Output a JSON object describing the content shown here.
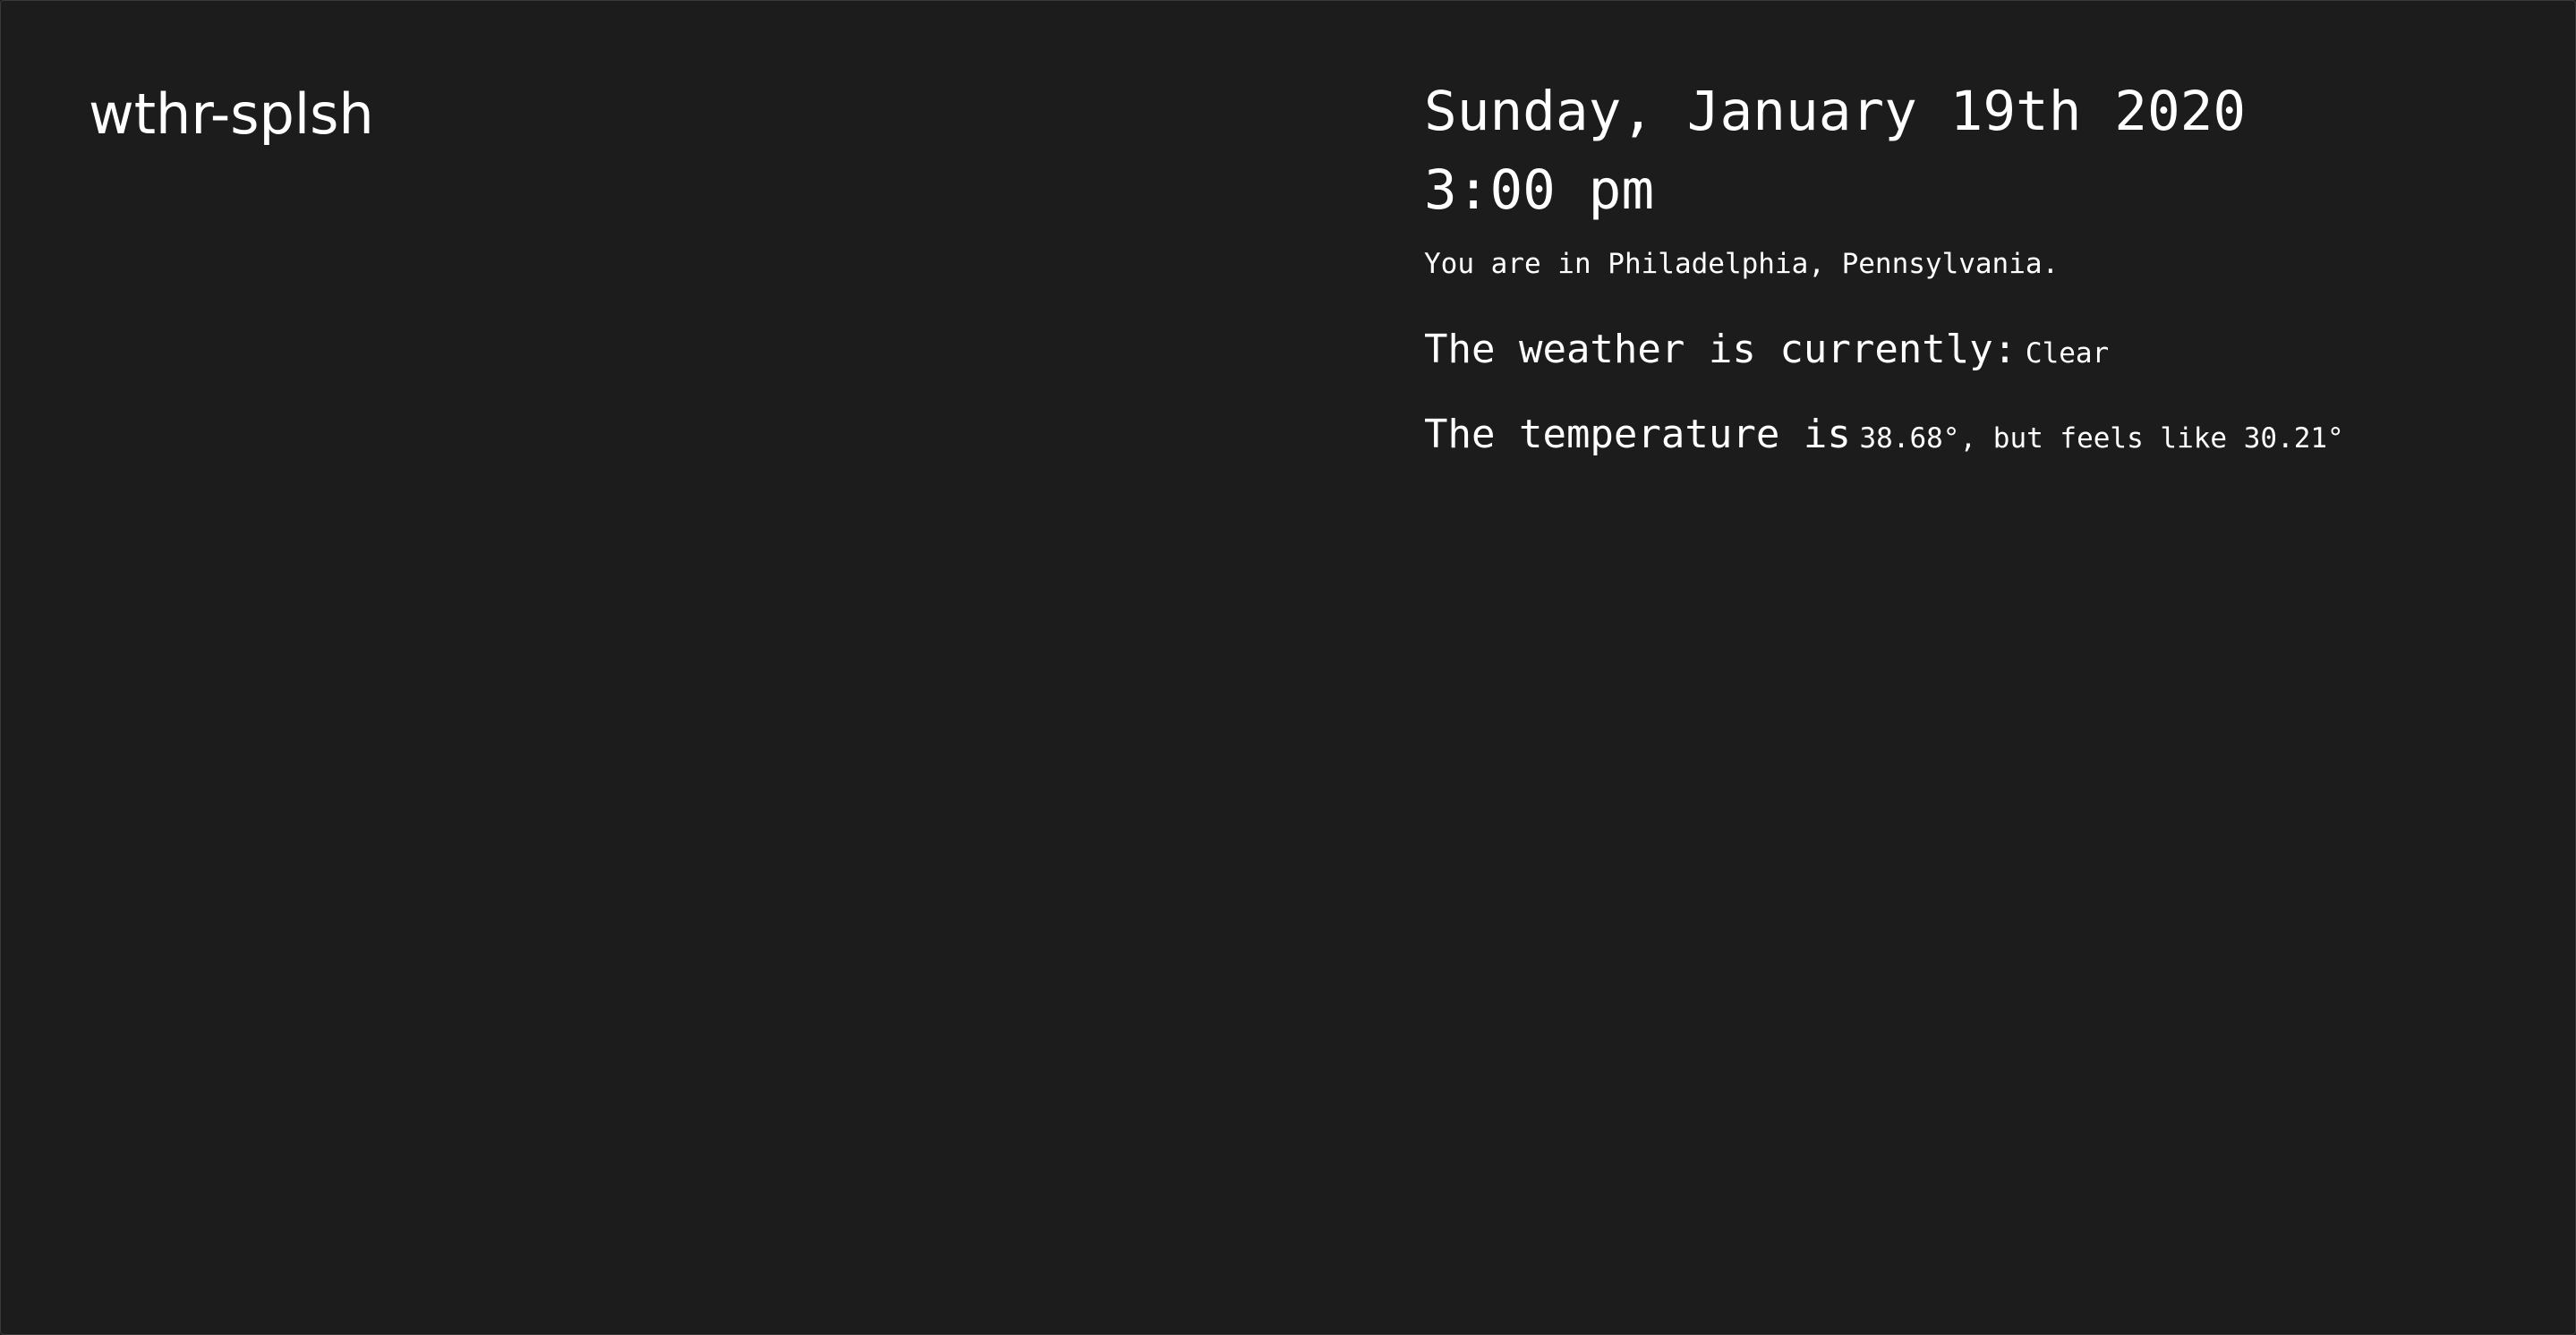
{
  "app": {
    "logo": "wthr-splsh"
  },
  "info": {
    "date": "Sunday, January 19th 2020",
    "time": "3:00 pm",
    "location": "You are in Philadelphia, Pennsylvania.",
    "weather_label": "The weather is currently:",
    "weather_value": "Clear",
    "temperature_label": "The temperature is",
    "temperature_value": "38.68°, but feels like 30.21°"
  },
  "colors": {
    "background": "#1d1c1d",
    "text": "#ffffff"
  }
}
